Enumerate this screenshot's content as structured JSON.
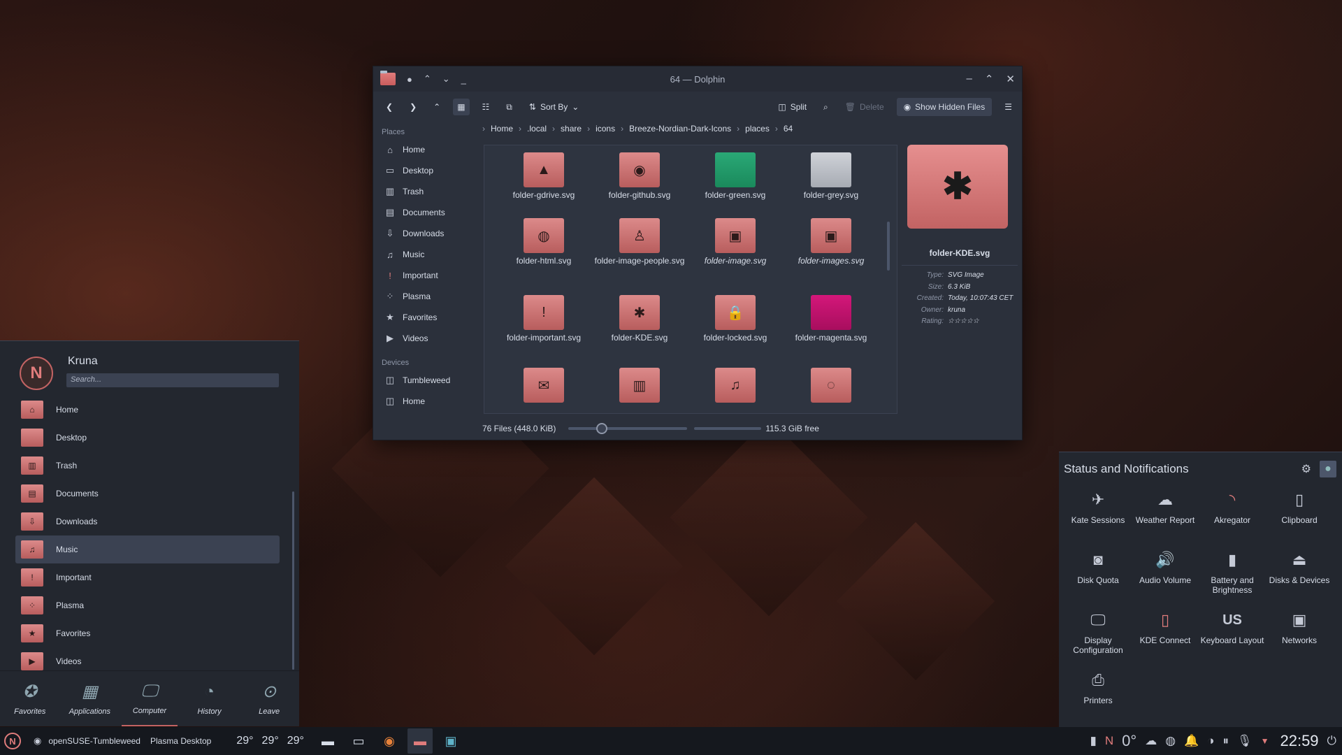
{
  "dolphin": {
    "title": "64 — Dolphin",
    "toolbar": {
      "sort_by": "Sort By",
      "split": "Split",
      "delete": "Delete",
      "show_hidden": "Show Hidden Files"
    },
    "sidebar": {
      "places_header": "Places",
      "places": [
        {
          "label": "Home",
          "icon": "home-icon"
        },
        {
          "label": "Desktop",
          "icon": "desktop-icon"
        },
        {
          "label": "Trash",
          "icon": "trash-icon"
        },
        {
          "label": "Documents",
          "icon": "documents-icon"
        },
        {
          "label": "Downloads",
          "icon": "downloads-icon"
        },
        {
          "label": "Music",
          "icon": "music-icon"
        },
        {
          "label": "Important",
          "icon": "important-icon"
        },
        {
          "label": "Plasma",
          "icon": "plasma-icon"
        },
        {
          "label": "Favorites",
          "icon": "star-icon"
        },
        {
          "label": "Videos",
          "icon": "videos-icon"
        }
      ],
      "devices_header": "Devices",
      "devices": [
        {
          "label": "Tumbleweed",
          "icon": "drive-icon"
        },
        {
          "label": "Home",
          "icon": "drive-icon"
        }
      ]
    },
    "breadcrumb": [
      "Home",
      ".local",
      "share",
      "icons",
      "Breeze-Nordian-Dark-Icons",
      "places",
      "64"
    ],
    "files": [
      {
        "name": "folder-gdrive.svg",
        "glyph": "▲",
        "variant": ""
      },
      {
        "name": "folder-github.svg",
        "glyph": "◉",
        "variant": ""
      },
      {
        "name": "folder-green.svg",
        "glyph": "",
        "variant": "green"
      },
      {
        "name": "folder-grey.svg",
        "glyph": "",
        "variant": "grey"
      },
      {
        "name": "folder-html.svg",
        "glyph": "◍",
        "variant": ""
      },
      {
        "name": "folder-image-people.svg",
        "glyph": "♙",
        "variant": ""
      },
      {
        "name": "folder-image.svg",
        "glyph": "▣",
        "variant": "",
        "italic": true
      },
      {
        "name": "folder-images.svg",
        "glyph": "▣",
        "variant": "",
        "italic": true
      },
      {
        "name": "folder-important.svg",
        "glyph": "!",
        "variant": ""
      },
      {
        "name": "folder-KDE.svg",
        "glyph": "✱",
        "variant": ""
      },
      {
        "name": "folder-locked.svg",
        "glyph": "🔒",
        "variant": ""
      },
      {
        "name": "folder-magenta.svg",
        "glyph": "",
        "variant": "magenta"
      },
      {
        "name": "",
        "glyph": "✉",
        "variant": ""
      },
      {
        "name": "",
        "glyph": "▥",
        "variant": ""
      },
      {
        "name": "",
        "glyph": "♫",
        "variant": ""
      },
      {
        "name": "",
        "glyph": "◌",
        "variant": ""
      }
    ],
    "info": {
      "name": "folder-KDE.svg",
      "rows": [
        {
          "k": "Type:",
          "v": "SVG Image"
        },
        {
          "k": "Size:",
          "v": "6.3 KiB"
        },
        {
          "k": "Created:",
          "v": "Today, 10:07:43 CET"
        },
        {
          "k": "Owner:",
          "v": "kruna"
        },
        {
          "k": "Rating:",
          "v": "☆☆☆☆☆"
        }
      ]
    },
    "status": {
      "count": "76 Files (448.0 KiB)",
      "free": "115.3 GiB free"
    }
  },
  "launcher": {
    "user": "Kruna",
    "search_placeholder": "Search...",
    "items": [
      {
        "label": "Home",
        "glyph": "⌂"
      },
      {
        "label": "Desktop",
        "glyph": ""
      },
      {
        "label": "Trash",
        "glyph": "▥"
      },
      {
        "label": "Documents",
        "glyph": "▤"
      },
      {
        "label": "Downloads",
        "glyph": "⇩"
      },
      {
        "label": "Music",
        "glyph": "♫"
      },
      {
        "label": "Important",
        "glyph": "!"
      },
      {
        "label": "Plasma",
        "glyph": "⁘"
      },
      {
        "label": "Favorites",
        "glyph": "★"
      },
      {
        "label": "Videos",
        "glyph": "▶"
      }
    ],
    "selected_index": 5,
    "tabs": [
      {
        "label": "Favorites",
        "icon": "favorites-icon",
        "glyph": "✪"
      },
      {
        "label": "Applications",
        "icon": "applications-icon",
        "glyph": "▦"
      },
      {
        "label": "Computer",
        "icon": "computer-icon",
        "glyph": "🖵"
      },
      {
        "label": "History",
        "icon": "history-icon",
        "glyph": "◔"
      },
      {
        "label": "Leave",
        "icon": "leave-icon",
        "glyph": "⊙"
      }
    ],
    "active_tab": 2
  },
  "notifications": {
    "title": "Status and Notifications",
    "items": [
      {
        "label": "Kate Sessions",
        "icon": "kate-icon",
        "glyph": "✈"
      },
      {
        "label": "Weather Report",
        "icon": "weather-icon",
        "glyph": "☁"
      },
      {
        "label": "Akregator",
        "icon": "rss-icon",
        "glyph": "◝"
      },
      {
        "label": "Clipboard",
        "icon": "clipboard-icon",
        "glyph": "▯"
      },
      {
        "label": "Disk Quota",
        "icon": "disk-quota-icon",
        "glyph": "◙"
      },
      {
        "label": "Audio Volume",
        "icon": "volume-icon",
        "glyph": "🔊"
      },
      {
        "label": "Battery and Brightness",
        "icon": "battery-icon",
        "glyph": "▮"
      },
      {
        "label": "Disks & Devices",
        "icon": "usb-icon",
        "glyph": "⏏"
      },
      {
        "label": "Display Configuration",
        "icon": "display-icon",
        "glyph": "🖵"
      },
      {
        "label": "KDE Connect",
        "icon": "phone-icon",
        "glyph": "▯"
      },
      {
        "label": "Keyboard Layout",
        "icon": "keyboard-icon",
        "glyph": "US"
      },
      {
        "label": "Networks",
        "icon": "network-icon",
        "glyph": "▣"
      },
      {
        "label": "Printers",
        "icon": "printer-icon",
        "glyph": "⎙"
      }
    ]
  },
  "taskbar": {
    "distro": "openSUSE-Tumbleweed",
    "desktop": "Plasma Desktop",
    "temps": [
      "29°",
      "29°",
      "29°"
    ],
    "weather_temp": "0°",
    "clock": "22:59"
  }
}
